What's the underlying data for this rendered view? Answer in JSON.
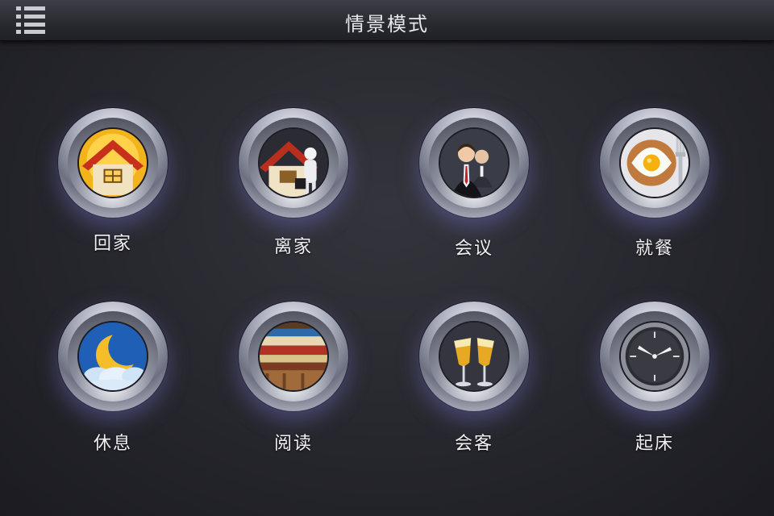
{
  "header": {
    "title": "情景模式"
  },
  "scenes": [
    {
      "label": "回家"
    },
    {
      "label": "离家"
    },
    {
      "label": "会议"
    },
    {
      "label": "就餐"
    },
    {
      "label": "休息"
    },
    {
      "label": "阅读"
    },
    {
      "label": "会客"
    },
    {
      "label": "起床"
    }
  ]
}
